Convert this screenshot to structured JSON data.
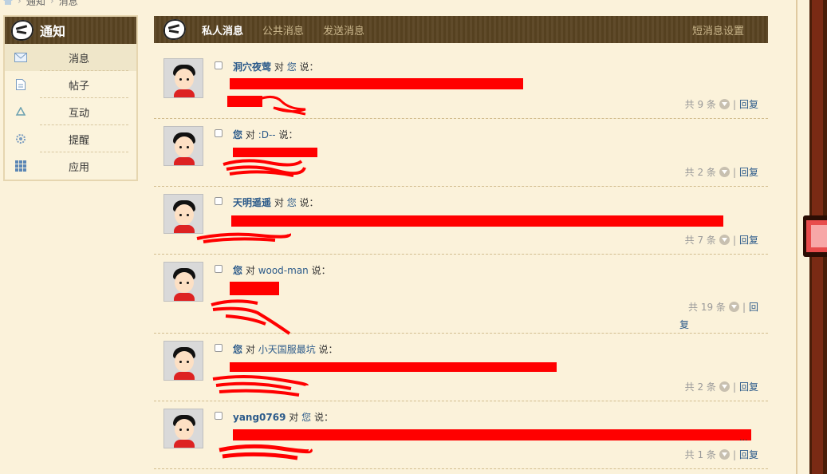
{
  "breadcrumb": {
    "items": [
      "通知",
      "消息"
    ]
  },
  "sidebar": {
    "title": "通知",
    "items": [
      {
        "label": "消息",
        "icon": "envelope-icon",
        "active": true
      },
      {
        "label": "帖子",
        "icon": "document-icon"
      },
      {
        "label": "互动",
        "icon": "recycle-icon"
      },
      {
        "label": "提醒",
        "icon": "gear-icon"
      },
      {
        "label": "应用",
        "icon": "grid-icon"
      }
    ]
  },
  "tabs": {
    "private": "私人消息",
    "public": "公共消息",
    "send": "发送消息",
    "settings": "短消息设置"
  },
  "messages": [
    {
      "from": "洞穴夜莺",
      "to": "您",
      "verb_to": "对",
      "verb_said": "说：",
      "count_text": "共 9 条",
      "reply": "回复"
    },
    {
      "from": "您",
      "to": ":D--",
      "verb_to": "对",
      "verb_said": "说：",
      "count_text": "共 2 条",
      "reply": "回复"
    },
    {
      "from": "天明遥遥",
      "to": "您",
      "verb_to": "对",
      "verb_said": "说：",
      "count_text": "共 7 条",
      "reply": "回复"
    },
    {
      "from": "您",
      "to": "wood-man",
      "verb_to": "对",
      "verb_said": "说：",
      "count_text": "共 19 条",
      "reply_a": "回",
      "reply_b": "复"
    },
    {
      "from": "您",
      "to": "小天国服最坑",
      "verb_to": "对",
      "verb_said": "说：",
      "count_text": "共 2 条",
      "reply": "回复"
    },
    {
      "from": "yang0769",
      "to": "您",
      "verb_to": "对",
      "verb_said": "说：",
      "count_text": "共 1 条",
      "reply": "回复",
      "ellipsis": "..."
    }
  ],
  "colors": {
    "header_bg": "#5a4422",
    "page_bg": "#fbf2da",
    "link": "#2b5a8a",
    "redaction": "#ff0000"
  }
}
